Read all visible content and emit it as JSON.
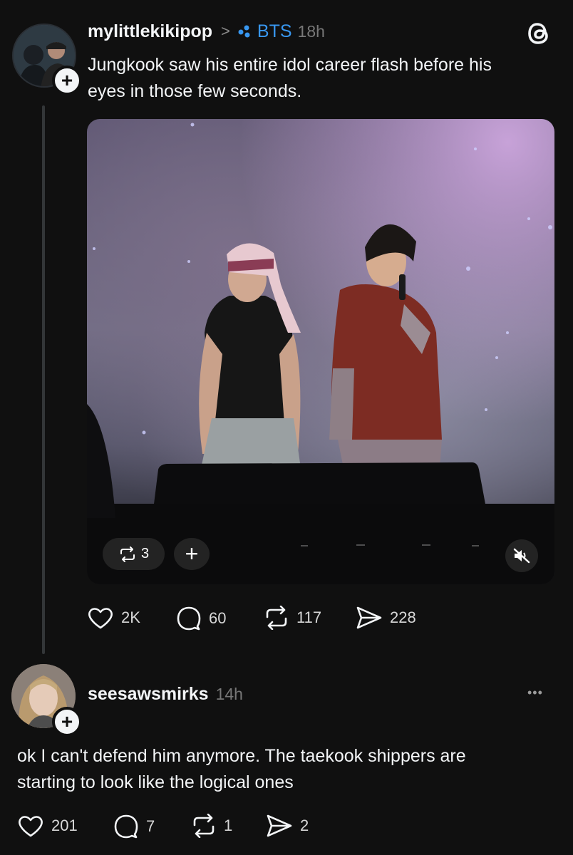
{
  "post": {
    "username": "mylittlekikipop",
    "breadcrumb_sep": ">",
    "tag": "BTS",
    "time": "18h",
    "text_line1": "Jungkook saw his entire idol career flash before his",
    "text_line2": "eyes in those few seconds.",
    "media": {
      "repost_count": "3",
      "plus": "+"
    },
    "stats": {
      "likes": "2K",
      "replies": "60",
      "reposts": "117",
      "shares": "228"
    }
  },
  "reply": {
    "username": "seesawsmirks",
    "time": "14h",
    "text_line1": "ok I can't defend him anymore. The taekook shippers are",
    "text_line2": "starting to look like the logical ones",
    "more": "•••",
    "stats": {
      "likes": "201",
      "replies": "7",
      "reposts": "1",
      "shares": "2"
    }
  },
  "icons": {
    "logo": "threads-logo-icon",
    "like": "heart-icon",
    "reply": "comment-icon",
    "repost": "repost-icon",
    "share": "send-icon",
    "mute": "muted-speaker-icon"
  },
  "colors": {
    "background": "#101010",
    "text": "#f3f5f7",
    "muted": "#777777",
    "link": "#3897f0"
  }
}
